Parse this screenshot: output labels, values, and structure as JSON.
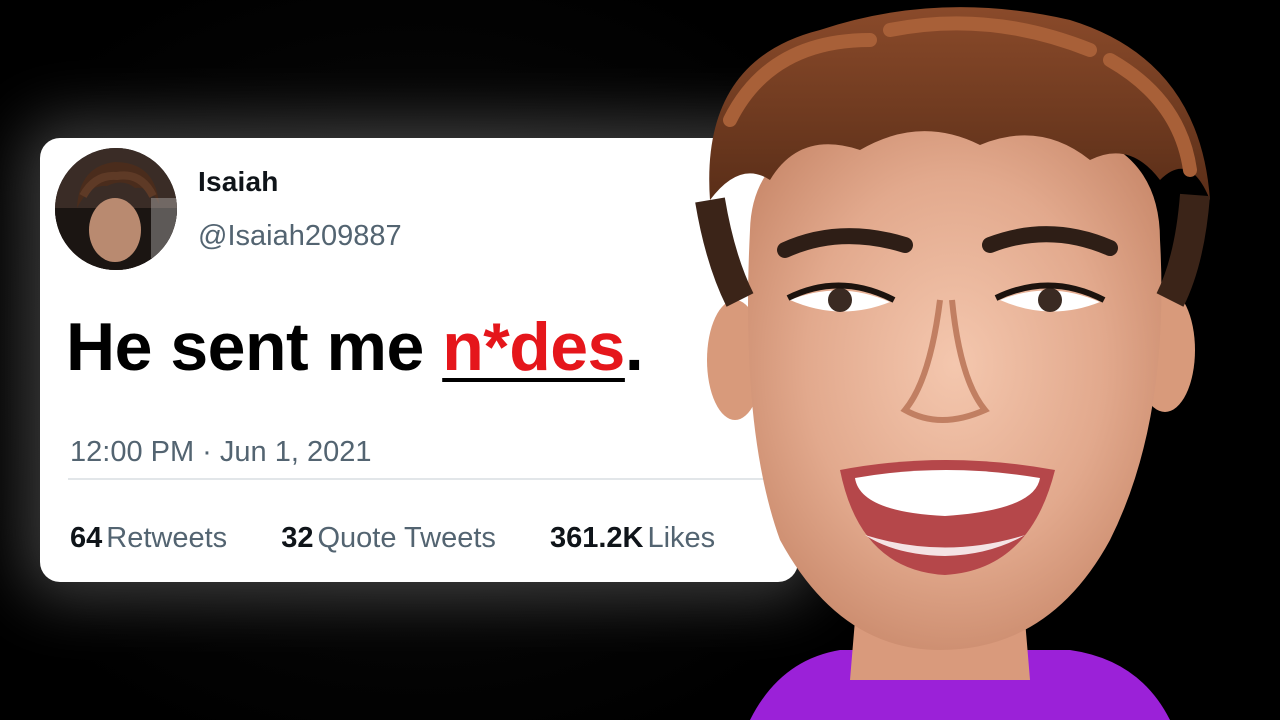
{
  "tweet": {
    "author_name": "Isaiah",
    "author_handle": "@Isaiah209887",
    "text_prefix": "He sent me ",
    "text_highlight": "n*des",
    "text_suffix": ".",
    "timestamp": "12:00 PM · Jun 1, 2021",
    "stats": [
      {
        "count": "64",
        "label": "Retweets"
      },
      {
        "count": "32",
        "label": "Quote Tweets"
      },
      {
        "count": "361.2K",
        "label": "Likes"
      }
    ]
  },
  "colors": {
    "background": "#000000",
    "card": "#ffffff",
    "highlight": "#e5161b",
    "secondary_text": "#536471",
    "shirt": "#9b21d8"
  },
  "icons": [
    "avatar-photo",
    "smiling-person-photo"
  ]
}
